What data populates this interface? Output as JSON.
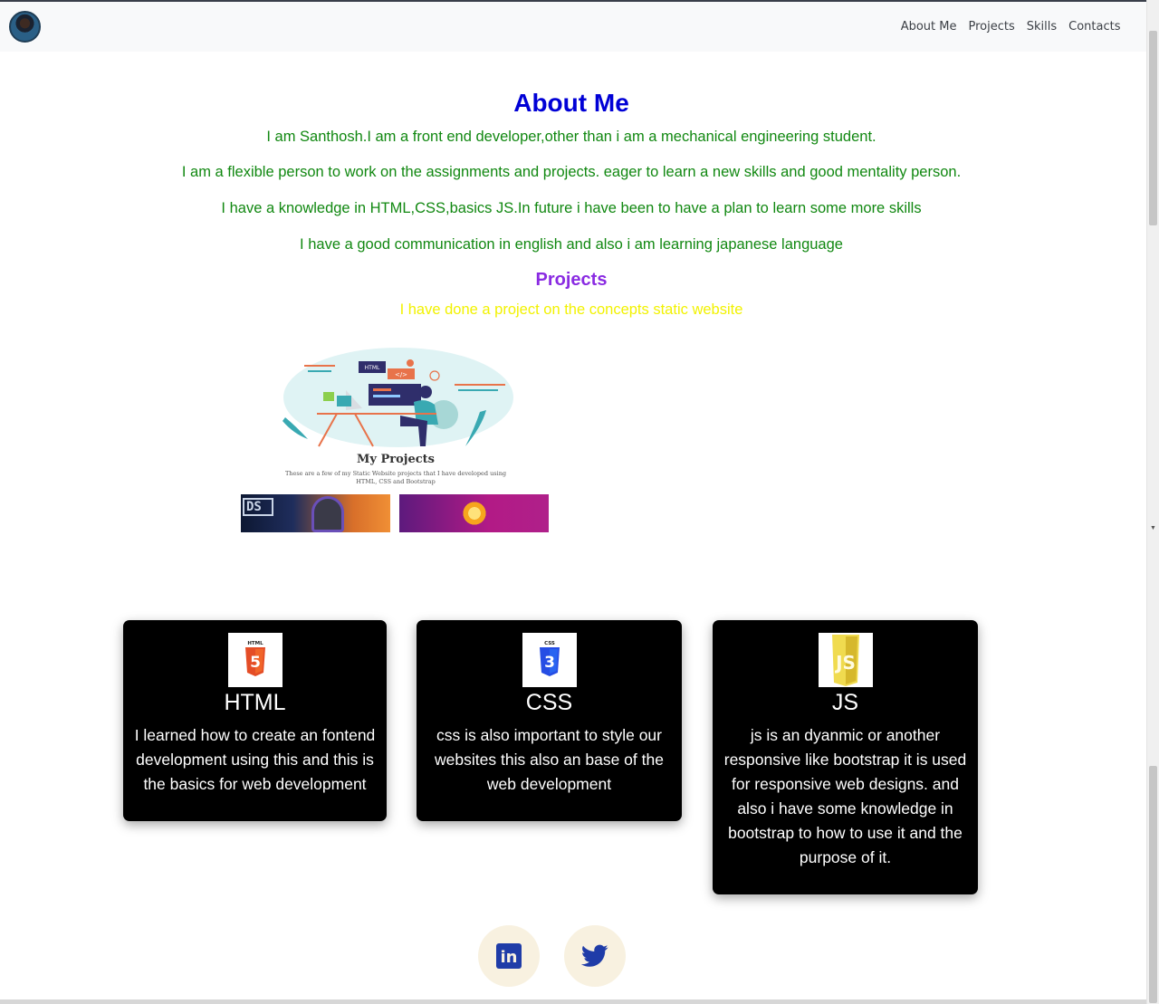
{
  "nav": {
    "items": [
      "About Me",
      "Projects",
      "Skills",
      "Contacts"
    ]
  },
  "about": {
    "title": "About Me",
    "paragraphs": [
      "I am Santhosh.I am a front end developer,other than i am a mechanical engineering student.",
      "I am a flexible person to work on the assignments and projects. eager to learn a new skills and good mentality person.",
      "I have a knowledge in HTML,CSS,basics JS.In future i have been to have a plan to learn some more skills",
      "I have a good communication in english and also i am learning japanese language"
    ]
  },
  "projects": {
    "title": "Projects",
    "text": "I have done a project on the concepts static website",
    "image": {
      "badge_html": "HTML",
      "badge_code": "</>",
      "title": "My Projects",
      "subtitle_line1": "These are a few of my Static Website projects that I have developed using",
      "subtitle_line2": "HTML, CSS and Bootstrap",
      "thumb1_text": "DS"
    }
  },
  "skills": [
    {
      "logo_text": "HTML",
      "logo_digit": "5",
      "logo_color": "#e44d26",
      "title": "HTML",
      "desc": "I learned how to create an fontend development using this and this is the basics for web development"
    },
    {
      "logo_text": "CSS",
      "logo_digit": "3",
      "logo_color": "#264de4",
      "title": "CSS",
      "desc": "css is also important to style our websites this also an base of the web development"
    },
    {
      "logo_text": "JS",
      "logo_digit": "JS",
      "logo_color": "#f0db4f",
      "title": "JS",
      "desc": "js is an dyanmic or another responsive like bootstrap it is used for responsive web designs. and also i have some knowledge in bootstrap to how to use it and the purpose of it."
    }
  ],
  "social": [
    {
      "icon": "linkedin-icon",
      "glyph": "in"
    },
    {
      "icon": "twitter-icon"
    }
  ],
  "colors": {
    "about_title": "#0000d6",
    "about_text": "#118811",
    "projects_title": "#8a2be2",
    "projects_text": "#f2f200",
    "card_bg": "#000000",
    "social_bg": "#f8f1e0",
    "social_icon": "#1f3ca8"
  }
}
